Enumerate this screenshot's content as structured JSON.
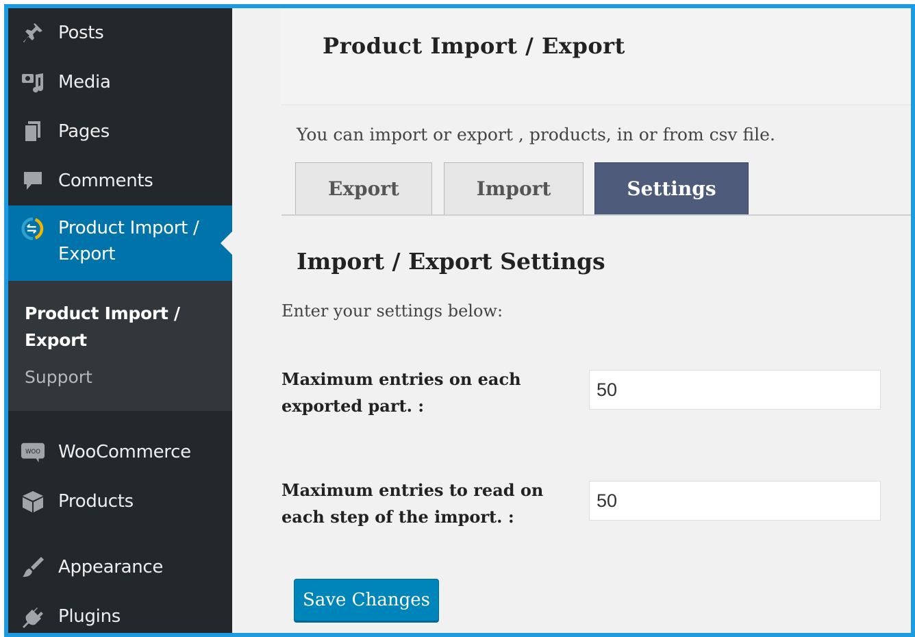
{
  "sidebar": {
    "items": [
      {
        "label": "Posts",
        "icon": "pin-icon"
      },
      {
        "label": "Media",
        "icon": "media-icon"
      },
      {
        "label": "Pages",
        "icon": "pages-icon"
      },
      {
        "label": "Comments",
        "icon": "comment-icon"
      },
      {
        "label": "Product Import / Export",
        "icon": "import-export-icon"
      },
      {
        "label": "WooCommerce",
        "icon": "woo-icon"
      },
      {
        "label": "Products",
        "icon": "box-icon"
      },
      {
        "label": "Appearance",
        "icon": "brush-icon"
      },
      {
        "label": "Plugins",
        "icon": "plug-icon"
      }
    ],
    "submenu": {
      "current": "Product Import / Export",
      "support": "Support"
    },
    "woo_badge": "WOO"
  },
  "page": {
    "title": "Product Import / Export",
    "intro": "You can import or export , products, in or from csv file.",
    "tabs": [
      {
        "label": "Export"
      },
      {
        "label": "Import"
      },
      {
        "label": "Settings"
      }
    ],
    "selected_tab": "Settings",
    "settings_title": "Import / Export Settings",
    "settings_desc": "Enter your settings below:",
    "fields": [
      {
        "label": "Maximum entries on each exported part. :",
        "value": "50"
      },
      {
        "label": "Maximum entries to read on each step of the import. :",
        "value": "50"
      }
    ],
    "save_label": "Save Changes"
  },
  "colors": {
    "sidebar_bg": "#23282d",
    "active_bg": "#0073aa",
    "selected_tab_bg": "#4f5b7a",
    "button_bg": "#0085ba",
    "frame_border": "#1e9be0"
  }
}
